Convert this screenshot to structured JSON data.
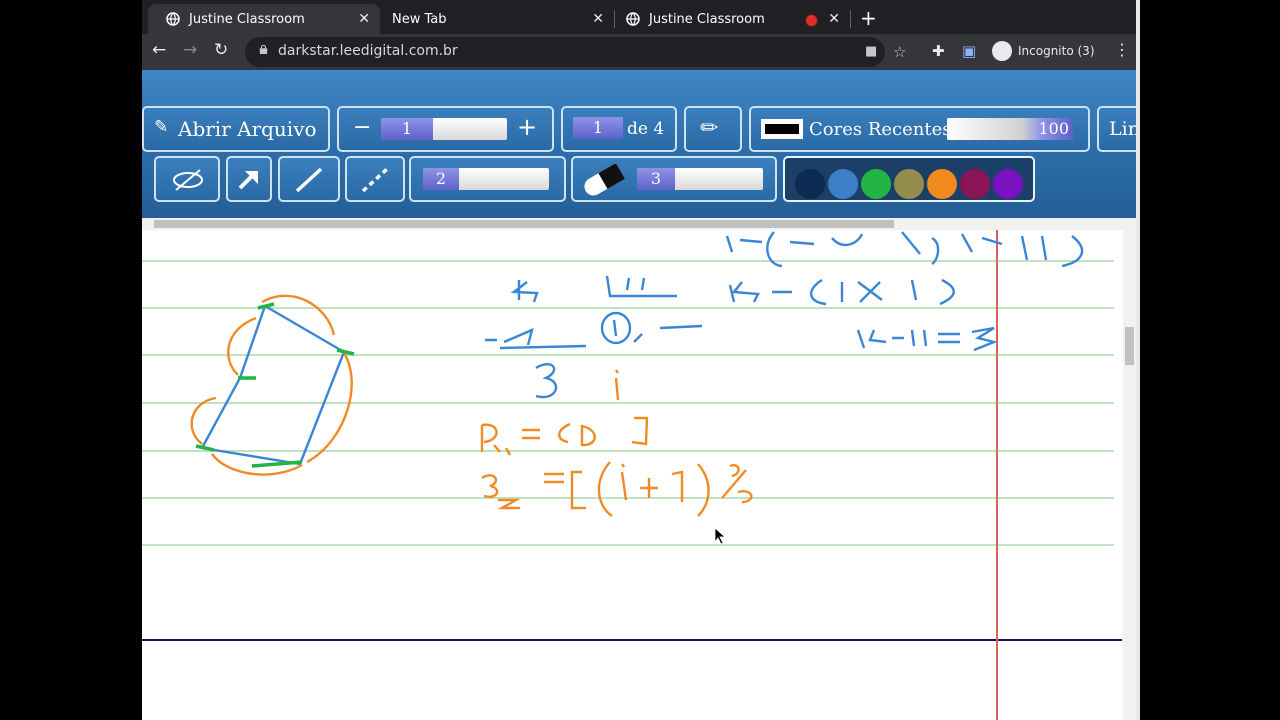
{
  "browser": {
    "tabs": [
      {
        "title": "Justine Classroom",
        "active": true
      },
      {
        "title": "New Tab",
        "active": false
      },
      {
        "title": "Justine Classroom",
        "active": false,
        "recording": true
      }
    ],
    "url": "darkstar.leedigital.com.br",
    "profile_label": "Incognito (3)"
  },
  "app": {
    "open_file_label": "Abrir Arquivo",
    "zoom_value": "1",
    "zoom_minus": "−",
    "zoom_plus": "+",
    "page_current": "1",
    "page_of_label": "de 4",
    "recent_colors_label": "Cores Recentes",
    "opacity_value": "100",
    "cut_label": "Lin",
    "pen_size_value": "2",
    "eraser_size_value": "3",
    "palette": [
      "#0d2a52",
      "#3d7fc8",
      "#22b445",
      "#948e4c",
      "#f08a1e",
      "#8a1457",
      "#7a10c2"
    ],
    "colors": {
      "toolbar": "#2f72b2",
      "ink_blue": "#3a86d6",
      "ink_orange": "#ef8a24",
      "margin_red": "#d9605f",
      "rule_green": "#bfe3bf"
    }
  },
  "notebook": {
    "blue_math": [
      "14 − (int(14/11) * 11)",
      "14  |11",
      "−11  (1)  —",
      "3",
      "14 − (1 * 11)",
      "14 − 11 = 3"
    ],
    "orange_math": [
      "i",
      "P1 = [0]",
      "P2 = [(i + 1) %"
    ]
  }
}
